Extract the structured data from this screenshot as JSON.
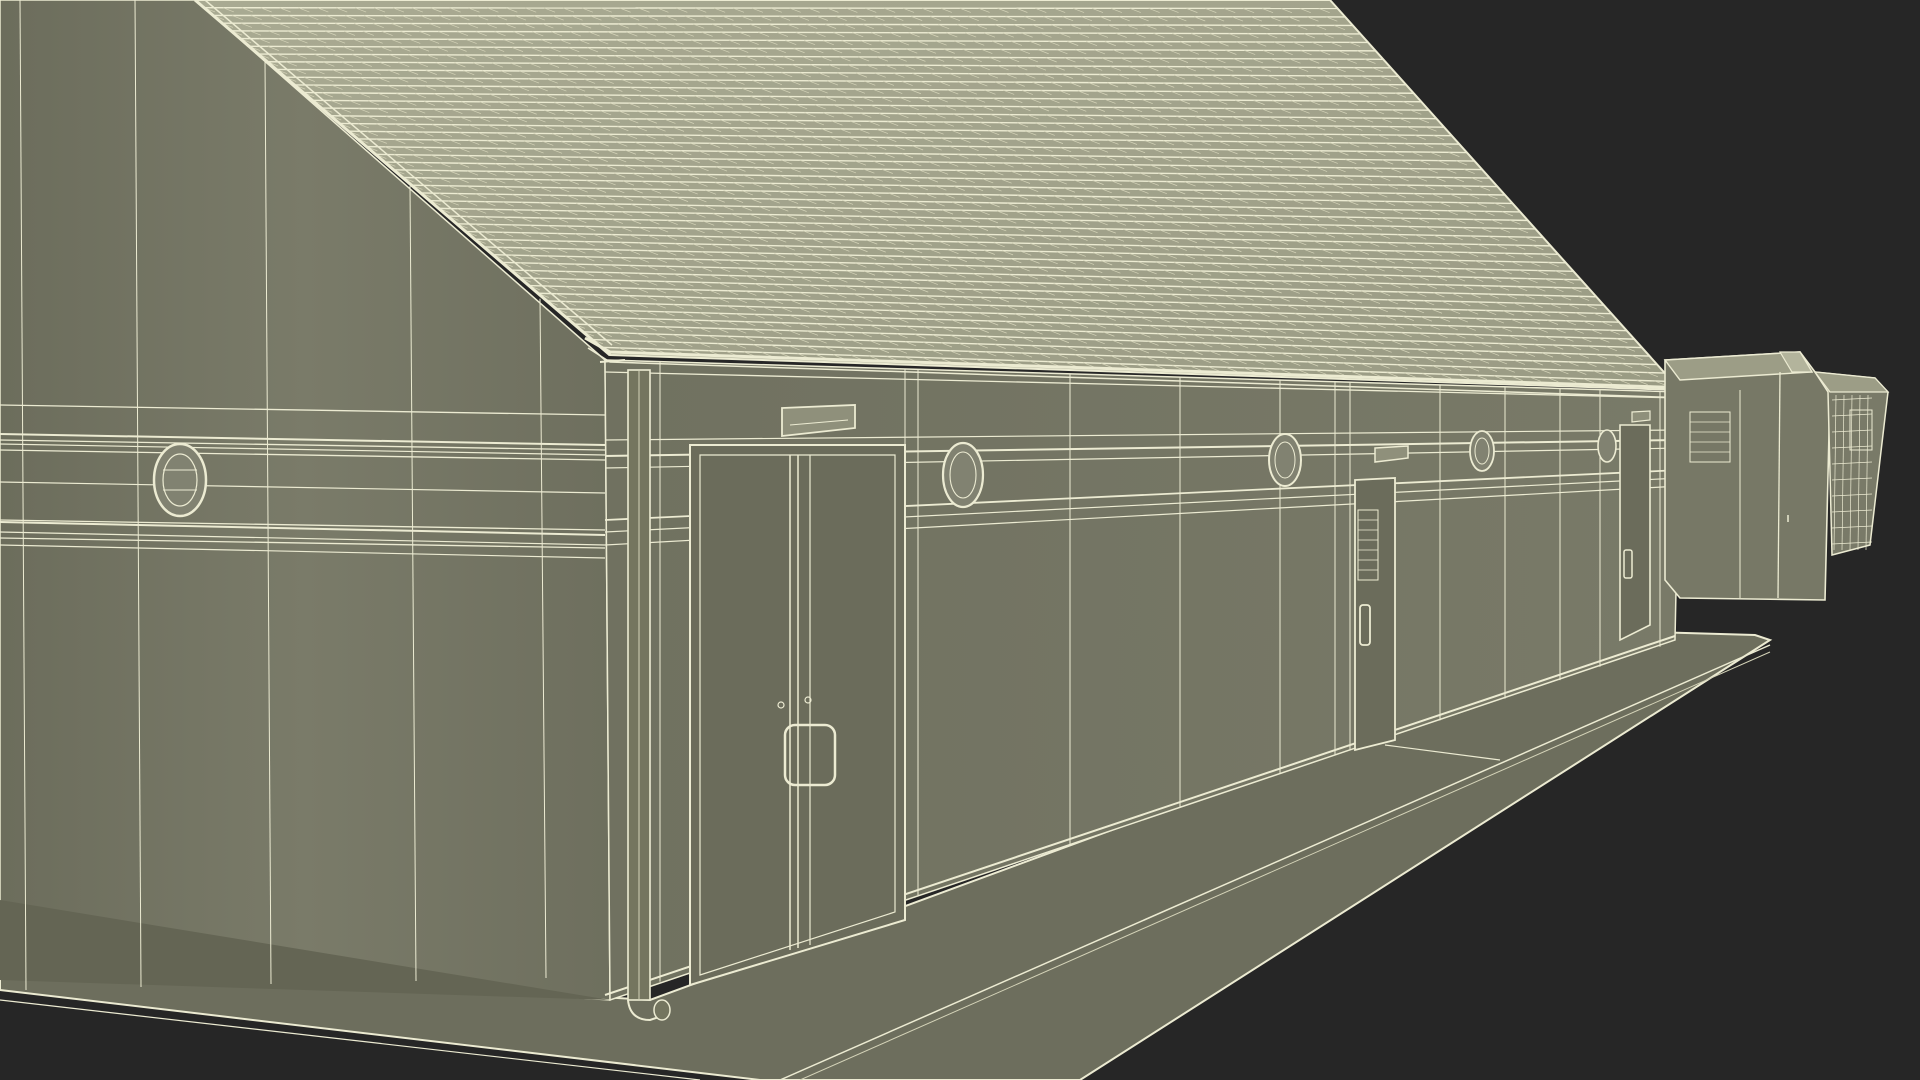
{
  "scene": {
    "subject": "wireframe-render",
    "colors": {
      "background": "#262626",
      "wall_base": "#737463",
      "wall_shadow": "#5f604f",
      "roof_base": "#9c9d86",
      "roof_light": "#b7b8a0",
      "sidewalk": "#6f705f",
      "wire": "#ecebd2",
      "wire_faint": "#d4d3b8"
    },
    "parts": [
      "gable-wall",
      "front-wall",
      "tiled-roof",
      "gutter",
      "downspout",
      "double-door",
      "single-door",
      "side-door",
      "wall-lamp",
      "sidewalk",
      "utility-box"
    ]
  }
}
